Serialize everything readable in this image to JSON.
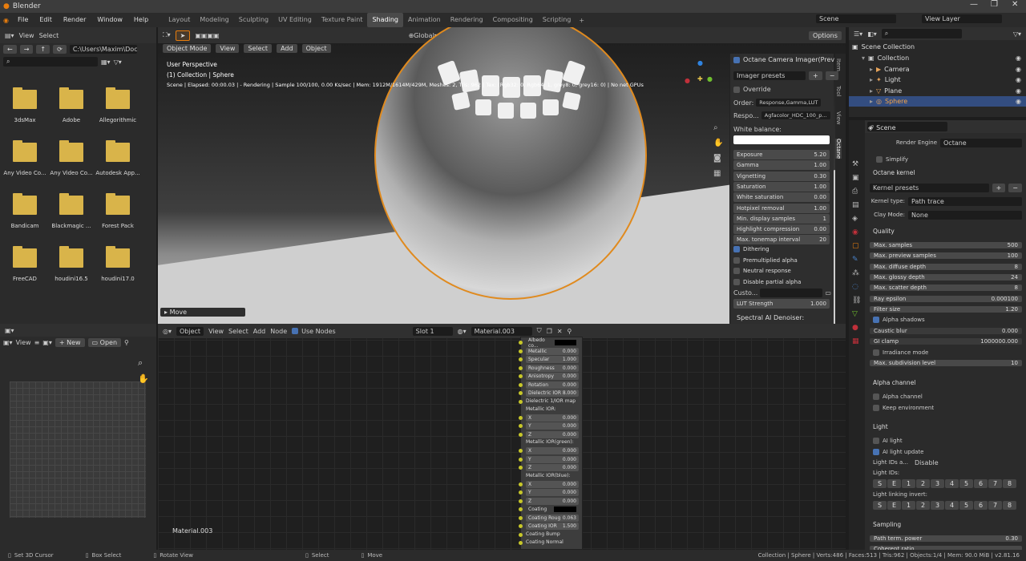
{
  "window": {
    "title": "Blender"
  },
  "menu": [
    "File",
    "Edit",
    "Render",
    "Window",
    "Help"
  ],
  "workspaces": [
    "Layout",
    "Modeling",
    "Sculpting",
    "UV Editing",
    "Texture Paint",
    "Shading",
    "Animation",
    "Rendering",
    "Compositing",
    "Scripting"
  ],
  "active_workspace": "Shading",
  "topbar": {
    "scene": "Scene",
    "view_layer": "View Layer"
  },
  "filebrowser": {
    "header": [
      "View",
      "Select"
    ],
    "path": "C:\\Users\\Maxim\\Docu...",
    "folders": [
      "3dsMax",
      "Adobe",
      "Allegorithmic",
      "Any Video Co...",
      "Any Video Co...",
      "Autodesk App...",
      "Bandicam",
      "Blackmagic ...",
      "Forest Pack",
      "FreeCAD",
      "houdini16.5",
      "houdini17.0"
    ]
  },
  "viewport": {
    "mode": "Object Mode",
    "header": [
      "View",
      "Select",
      "Add",
      "Object"
    ],
    "orientation": "Global",
    "options": "Options",
    "overlay_title": "User Perspective",
    "overlay_collection": "(1) Collection | Sphere",
    "overlay_status": "Scene | Elapsed: 00:00.03 |  - Rendering | Sample 100/100, 0.00 Ks/sec | Mem: 1912M/1614M/429M, Meshes: 2, Tris: 962 | Tex: (Rgb32: 0, Rgb64: 1, grey8: 0, grey16: 0) | No net GPUs",
    "move_label": "Move",
    "side_tabs": [
      "Item",
      "Tool",
      "View",
      "Octane"
    ]
  },
  "octane_panel": {
    "title": "Octane Camera Imager(Prev",
    "imager_presets": "Imager presets",
    "override": "Override",
    "order_label": "Order:",
    "order_value": "Response,Gamma,LUT",
    "response_label": "Respo...",
    "response_value": "Agfacolor_HDC_100_p...",
    "white_balance": "White balance:",
    "sliders": [
      {
        "label": "Exposure",
        "value": "5.20"
      },
      {
        "label": "Gamma",
        "value": "1.00"
      },
      {
        "label": "Vignetting",
        "value": "0.30"
      },
      {
        "label": "Saturation",
        "value": "1.00"
      },
      {
        "label": "White saturation",
        "value": "0.00"
      },
      {
        "label": "Hotpixel removal",
        "value": "1.00"
      },
      {
        "label": "Min. display samples",
        "value": "1"
      },
      {
        "label": "Highlight compression",
        "value": "0.00"
      },
      {
        "label": "Max. tonemap interval",
        "value": "20"
      }
    ],
    "checks": [
      {
        "label": "Dithering",
        "on": true
      },
      {
        "label": "Premultiplied alpha",
        "on": false
      },
      {
        "label": "Neutral response",
        "on": false
      },
      {
        "label": "Disable partial alpha",
        "on": false
      }
    ],
    "custom_label": "Custo...",
    "lut_strength_label": "LUT Strength",
    "lut_strength_value": "1.000",
    "denoiser": "Spectral AI Denoiser:"
  },
  "outliner": {
    "search": "",
    "root": "Scene Collection",
    "items": [
      "Collection",
      "Camera",
      "Light",
      "Plane",
      "Sphere"
    ]
  },
  "properties": {
    "scene": "Scene",
    "render_engine_label": "Render Engine",
    "render_engine": "Octane",
    "simplify": "Simplify",
    "kernel_section": "Octane kernel",
    "kernel_presets": "Kernel presets",
    "kernel_type_label": "Kernel type:",
    "kernel_type": "Path trace",
    "clay_mode_label": "Clay Mode:",
    "clay_mode": "None",
    "quality": "Quality",
    "quality_rows": [
      {
        "label": "Max. samples",
        "value": "500"
      },
      {
        "label": "Max. preview samples",
        "value": "100"
      },
      {
        "label": "Max. diffuse depth",
        "value": "8"
      },
      {
        "label": "Max. glossy depth",
        "value": "24"
      },
      {
        "label": "Max. scatter depth",
        "value": "8"
      },
      {
        "label": "Ray epsilon",
        "value": "0.000100"
      },
      {
        "label": "Filter size",
        "value": "1.20"
      }
    ],
    "alpha_shadows": "Alpha shadows",
    "caustic_blur_label": "Caustic blur",
    "caustic_blur": "0.000",
    "gi_clamp_label": "GI clamp",
    "gi_clamp": "1000000.000",
    "irradiance_mode": "Irradiance mode",
    "max_subdiv_label": "Max. subdivision level",
    "max_subdiv": "10",
    "alpha_channel_section": "Alpha channel",
    "alpha_channel": "Alpha channel",
    "keep_environment": "Keep environment",
    "light_section": "Light",
    "ai_light": "AI light",
    "ai_light_update": "AI light update",
    "light_ids_a_label": "Light IDs a...",
    "light_ids_a": "Disable",
    "light_ids_label": "Light IDs:",
    "light_ids": [
      "S",
      "E",
      "1",
      "2",
      "3",
      "4",
      "5",
      "6",
      "7",
      "8"
    ],
    "light_invert_label": "Light linking invert:",
    "sampling_section": "Sampling",
    "path_term_label": "Path term. power",
    "path_term": "0.30",
    "coherent_label": "Coherent ratio"
  },
  "node_editor": {
    "mode": "Object",
    "header": [
      "View",
      "Select",
      "Add",
      "Node"
    ],
    "use_nodes": "Use Nodes",
    "slot": "Slot 1",
    "material": "Material.003",
    "material_label": "Material.003",
    "node_rows": [
      {
        "label": "Albedo co...",
        "value": ""
      },
      {
        "label": "Metallic",
        "value": "0.000"
      },
      {
        "label": "Specular",
        "value": "1.000"
      },
      {
        "label": "Roughness",
        "value": "0.000"
      },
      {
        "label": "Anisotropy",
        "value": "0.000"
      },
      {
        "label": "Rotation",
        "value": "0.000"
      },
      {
        "label": "Dielectric IOR",
        "value": "8.000"
      }
    ],
    "dielectric_map": "Dielectric 1/IOR map",
    "metallic_ior": "Metallic IOR:",
    "metallic_green": "Metallic IOR(green):",
    "metallic_blue": "Metallic IOR(blue):",
    "xyz": [
      {
        "label": "X",
        "value": "0.000"
      },
      {
        "label": "Y",
        "value": "0.000"
      },
      {
        "label": "Z",
        "value": "0.000"
      }
    ],
    "coating": "Coating",
    "coating_rough": {
      "label": "Coating Roug",
      "value": "0.063"
    },
    "coating_ior": {
      "label": "Coating IOR",
      "value": "1.500"
    },
    "coating_bump": "Coating Bump",
    "coating_normal": "Coating Normal"
  },
  "image_editor": {
    "view": "View",
    "new": "New",
    "open": "Open"
  },
  "statusbar": {
    "left": [
      "Set 3D Cursor",
      "Box Select",
      "Rotate View",
      "Select",
      "Move"
    ],
    "right": "Collection | Sphere | Verts:486 | Faces:513 | Tris:962 | Objects:1/4 | Mem: 90.0 MiB | v2.81.16"
  }
}
